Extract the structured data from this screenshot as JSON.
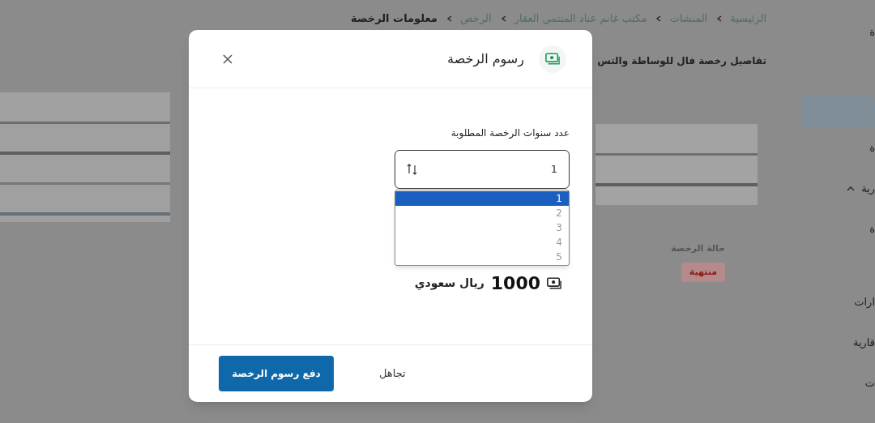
{
  "breadcrumb": [
    {
      "label": "الرئيسية",
      "current": false
    },
    {
      "label": "المنشات",
      "current": false
    },
    {
      "label": "مكتب غانم عناد المنتمي العقار",
      "current": false
    },
    {
      "label": "الرخص",
      "current": false
    },
    {
      "label": "معلومات الرخصة",
      "current": true
    }
  ],
  "page_heading": "تفاصيل رخصة فال للوساطة والتس",
  "status": {
    "label": "حالة الرخصة",
    "badge": "منتهية"
  },
  "sidebar": {
    "top_label": "ة",
    "items": [
      {
        "label": "ة",
        "kind": "link"
      },
      {
        "label": "رية",
        "kind": "group",
        "expanded": true
      },
      {
        "label": "ة",
        "kind": "link"
      },
      {
        "label": "ارات",
        "kind": "link"
      },
      {
        "label": "قارية",
        "kind": "link"
      },
      {
        "label": "ت",
        "kind": "link"
      }
    ]
  },
  "dialog": {
    "title": "رسوم الرخصة",
    "field": {
      "label": "عدد سنوات الرخصة المطلوبة",
      "value": "1",
      "options": [
        {
          "label": "1",
          "selected": true
        },
        {
          "label": "2",
          "selected": false
        },
        {
          "label": "3",
          "selected": false
        },
        {
          "label": "4",
          "selected": false
        },
        {
          "label": "5",
          "selected": false
        }
      ]
    },
    "price": {
      "amount": "1000",
      "currency": "ريال سعودي"
    },
    "buttons": [
      {
        "label": "تجاهل",
        "kind": "secondary"
      },
      {
        "label": "دفع رسوم الرخصة",
        "kind": "primary"
      }
    ]
  }
}
